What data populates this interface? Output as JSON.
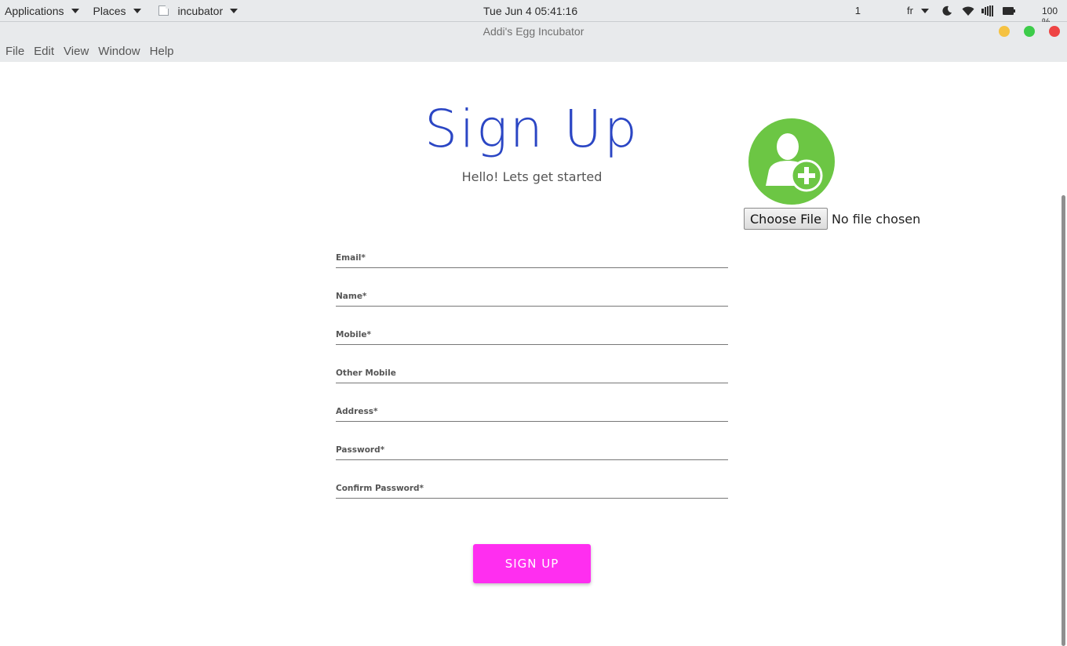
{
  "panel": {
    "applications": "Applications",
    "places": "Places",
    "app_name": "incubator",
    "clock": "Tue Jun 4  05:41:16",
    "workspace": "1",
    "keyboard": "fr",
    "battery": "100 %"
  },
  "window": {
    "title": "Addi's Egg Incubator",
    "menus": [
      "File",
      "Edit",
      "View",
      "Window",
      "Help"
    ]
  },
  "page": {
    "heading": "Sign Up",
    "subheading": "Hello! Lets get started",
    "file_button": "Choose File",
    "file_status": "No file chosen",
    "fields": [
      {
        "label": "Email*"
      },
      {
        "label": "Name*"
      },
      {
        "label": "Mobile*"
      },
      {
        "label": "Other Mobile"
      },
      {
        "label": "Address*"
      },
      {
        "label": "Password*"
      },
      {
        "label": "Confirm Password*"
      }
    ],
    "submit": "SIGN UP"
  },
  "colors": {
    "heading": "#2b46c4",
    "avatar": "#6cc644",
    "submit": "#ff2ef0",
    "close": "#ee4444",
    "minimize": "#f5c242",
    "maximize": "#3dcc4a"
  }
}
